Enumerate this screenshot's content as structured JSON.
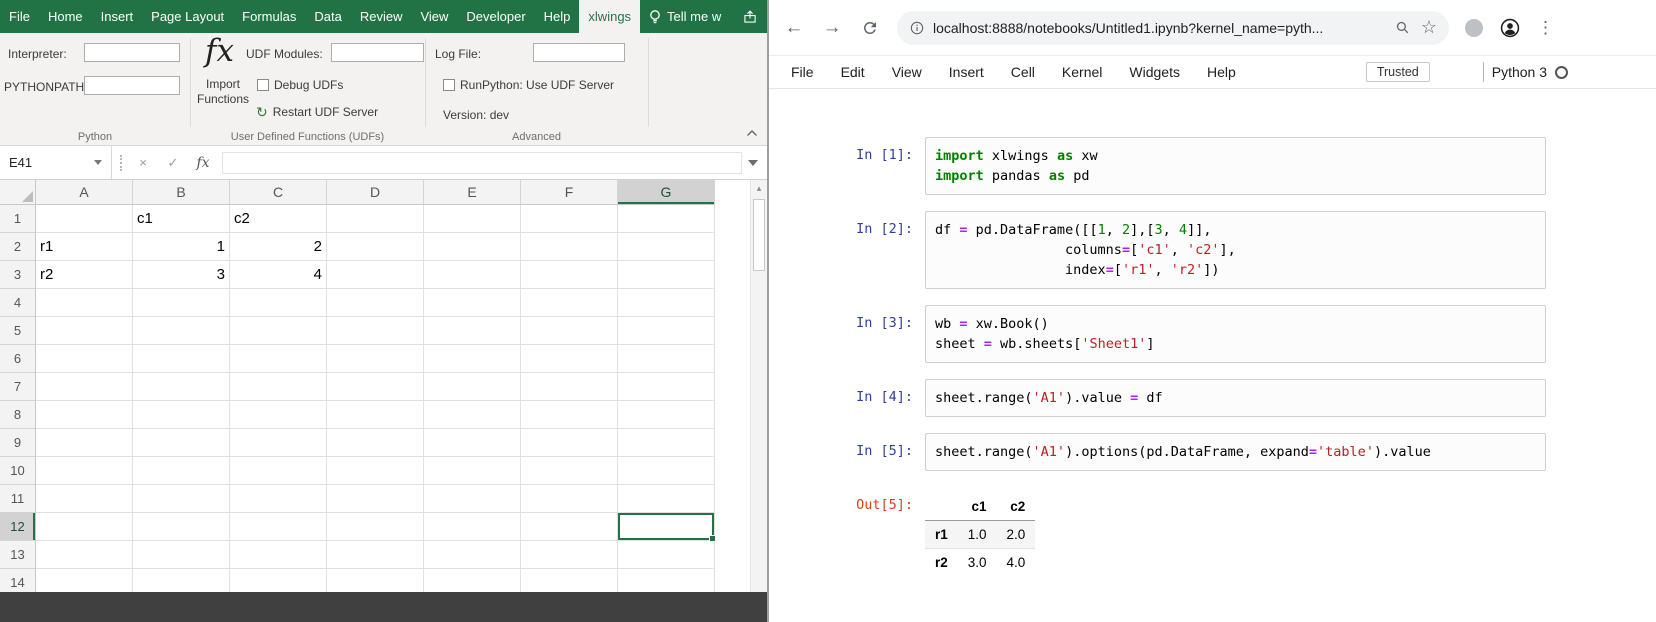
{
  "icons": {
    "back": "←",
    "forward": "→",
    "star": "☆",
    "kebab": "⋮",
    "scroll_up": "▴",
    "restart": "↻"
  },
  "excel": {
    "tabs": [
      "File",
      "Home",
      "Insert",
      "Page Layout",
      "Formulas",
      "Data",
      "Review",
      "View",
      "Developer",
      "Help"
    ],
    "active_tab": "xlwings",
    "tell_me_label": "Tell me w",
    "ribbon": {
      "interpreter_label": "Interpreter:",
      "pythonpath_label": "PYTHONPATH:",
      "python_group_label": "Python",
      "fx_glyph": "fx",
      "import_functions_label": "Import Functions",
      "udf_modules_label": "UDF Modules:",
      "debug_udfs_label": "Debug UDFs",
      "restart_udf_label": "Restart UDF Server",
      "udf_group_label": "User Defined Functions (UDFs)",
      "log_file_label": "Log File:",
      "runpython_label": "RunPython: Use UDF Server",
      "version_label": "Version: dev",
      "advanced_group_label": "Advanced"
    },
    "formula_bar": {
      "name_box_value": "E41",
      "cancel_glyph": "×",
      "enter_glyph": "✓",
      "fx_label": "fx"
    },
    "grid": {
      "columns": [
        "A",
        "B",
        "C",
        "D",
        "E",
        "F",
        "G"
      ],
      "row_count": 14,
      "cells": {
        "B1": "c1",
        "C1": "c2",
        "A2": "r1",
        "B2": "1",
        "C2": "2",
        "A3": "r2",
        "B3": "3",
        "C3": "4"
      },
      "selected_cell": "G12"
    }
  },
  "browser": {
    "toolbar": {
      "url": "localhost:8888/notebooks/Untitled1.ipynb?kernel_name=pyth..."
    },
    "menubar": {
      "items": [
        "File",
        "Edit",
        "View",
        "Insert",
        "Cell",
        "Kernel",
        "Widgets",
        "Help"
      ],
      "trusted_label": "Trusted",
      "kernel_name": "Python 3"
    }
  },
  "notebook": {
    "cells": [
      {
        "prompt": "In [1]:",
        "lines": [
          [
            [
              "kw",
              "import"
            ],
            [
              "pl",
              " xlwings "
            ],
            [
              "kw",
              "as"
            ],
            [
              "pl",
              " xw"
            ]
          ],
          [
            [
              "kw",
              "import"
            ],
            [
              "pl",
              " pandas "
            ],
            [
              "kw",
              "as"
            ],
            [
              "pl",
              " pd"
            ]
          ]
        ]
      },
      {
        "prompt": "In [2]:",
        "lines": [
          [
            [
              "pl",
              "df "
            ],
            [
              "op",
              "="
            ],
            [
              "pl",
              " pd.DataFrame([["
            ],
            [
              "num",
              "1"
            ],
            [
              "pl",
              ", "
            ],
            [
              "num",
              "2"
            ],
            [
              "pl",
              "],["
            ],
            [
              "num",
              "3"
            ],
            [
              "pl",
              ", "
            ],
            [
              "num",
              "4"
            ],
            [
              "pl",
              "]],"
            ]
          ],
          [
            [
              "pl",
              "                columns"
            ],
            [
              "op",
              "="
            ],
            [
              "pl",
              "["
            ],
            [
              "str",
              "'c1'"
            ],
            [
              "pl",
              ", "
            ],
            [
              "str",
              "'c2'"
            ],
            [
              "pl",
              "],"
            ]
          ],
          [
            [
              "pl",
              "                index"
            ],
            [
              "op",
              "="
            ],
            [
              "pl",
              "["
            ],
            [
              "str",
              "'r1'"
            ],
            [
              "pl",
              ", "
            ],
            [
              "str",
              "'r2'"
            ],
            [
              "pl",
              "])"
            ]
          ]
        ]
      },
      {
        "prompt": "In [3]:",
        "lines": [
          [
            [
              "pl",
              "wb "
            ],
            [
              "op",
              "="
            ],
            [
              "pl",
              " xw.Book()"
            ]
          ],
          [
            [
              "pl",
              "sheet "
            ],
            [
              "op",
              "="
            ],
            [
              "pl",
              " wb.sheets["
            ],
            [
              "str",
              "'Sheet1'"
            ],
            [
              "pl",
              "]"
            ]
          ]
        ]
      },
      {
        "prompt": "In [4]:",
        "lines": [
          [
            [
              "pl",
              "sheet.range("
            ],
            [
              "str",
              "'A1'"
            ],
            [
              "pl",
              ").value "
            ],
            [
              "op",
              "="
            ],
            [
              "pl",
              " df"
            ]
          ]
        ]
      },
      {
        "prompt": "In [5]:",
        "lines": [
          [
            [
              "pl",
              "sheet.range("
            ],
            [
              "str",
              "'A1'"
            ],
            [
              "pl",
              ").options(pd.DataFrame, expand"
            ],
            [
              "op",
              "="
            ],
            [
              "str",
              "'table'"
            ],
            [
              "pl",
              ").value"
            ]
          ]
        ]
      }
    ],
    "output": {
      "prompt": "Out[5]:",
      "table": {
        "col_headers": [
          "c1",
          "c2"
        ],
        "rows": [
          {
            "index": "r1",
            "values": [
              "1.0",
              "2.0"
            ]
          },
          {
            "index": "r2",
            "values": [
              "3.0",
              "4.0"
            ]
          }
        ]
      }
    }
  },
  "colors": {
    "excel_green": "#217346",
    "prompt_in": "#303F9F",
    "prompt_out": "#D84315",
    "keyword": "#008000",
    "operator": "#AA22FF",
    "string": "#BA2121",
    "number": "#008000"
  }
}
